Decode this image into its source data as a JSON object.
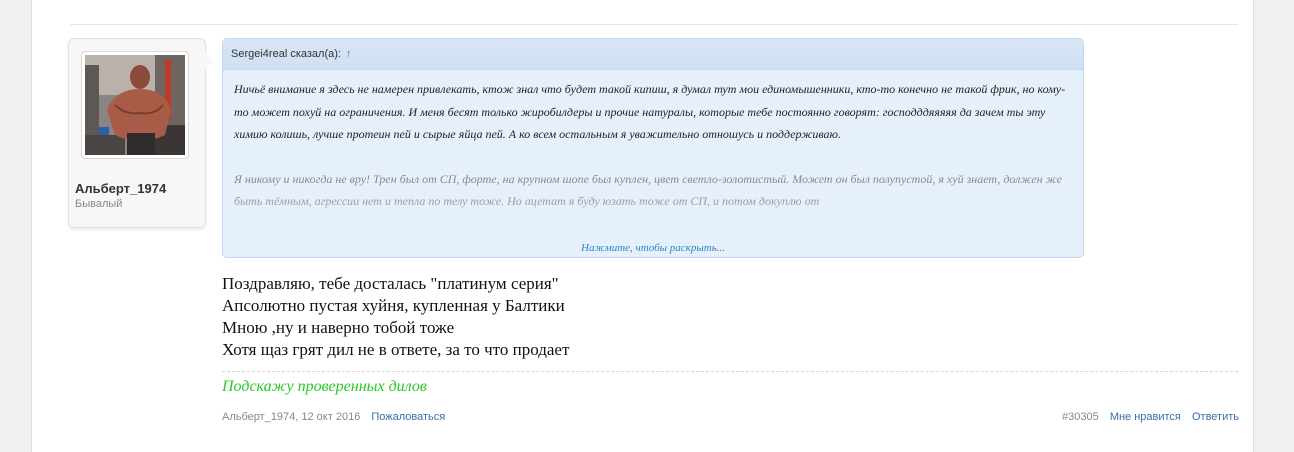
{
  "user": {
    "name": "Альберт_1974",
    "title": "Бывалый"
  },
  "quote": {
    "header_author": "Sergei4real сказал(а):",
    "header_arrow": "↑",
    "paragraph_1": "Ничьё внимание я здесь не намерен привлекать, ктож знал что будет такой кипиш, я думал тут мои единомышенники, кто-то конечно не такой фрик, но кому-то может похуй на ограничения. И меня бесят только жиробилдеры и прочие натуралы, которые тебе постоянно говорят: господддяяяяя да зачем ты эту химию колишь, лучше протеин пей и сырые яйца пей. А ко всем остальным я уважительно отношусь и поддерживаю.",
    "paragraph_2": "Я никому и никогда не вру! Трен был от СП, форте, на крупном шопе был куплен, цвет светло-золотистый. Может он был полупустой, я хуй знает, должен же быть тёмным, агрессии нет и тепла по телу тоже. Но ацетат я буду юзать тоже от СП, и потом докуплю от",
    "expand_label": "Нажмите, чтобы раскрыть..."
  },
  "message": {
    "lines": [
      "Поздравляю, тебе досталась \"платинум серия\"",
      "Апсолютно пустая хуйня, купленная у Балтики",
      "Мною ,ну и наверно тобой тоже",
      "Хотя щаз грят дил не в ответе, за то что продает"
    ]
  },
  "signature": "Подскажу проверенных дилов",
  "footer": {
    "author_date": "Альберт_1974, 12 окт 2016",
    "report": "Пожаловаться",
    "post_number": "#30305",
    "like": "Мне нравится",
    "reply": "Ответить"
  },
  "colors": {
    "signature": "#27c927",
    "link": "#3a6ea5",
    "quote_bg": "#e6f0fb"
  }
}
